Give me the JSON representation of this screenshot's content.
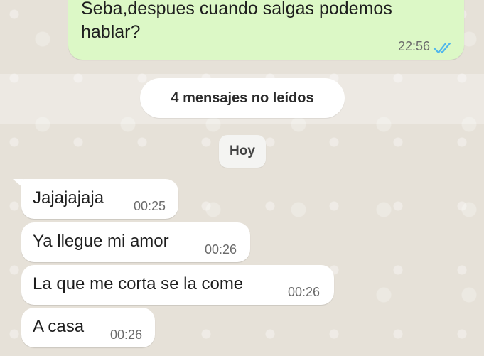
{
  "outgoing_message": {
    "text": "Seba,despues cuando salgas podemos hablar?",
    "time": "22:56",
    "status_icon": "double-check-read-icon",
    "bubble_color": "#dcf8c6",
    "tick_color": "#4fb6ec"
  },
  "unread_notice": {
    "label": "4 mensajes no leídos"
  },
  "date_separator": {
    "label": "Hoy"
  },
  "incoming_messages": [
    {
      "text": "Jajajajaja",
      "time": "00:25"
    },
    {
      "text": "Ya llegue mi amor",
      "time": "00:26"
    },
    {
      "text": "La que me corta se la come",
      "time": "00:26"
    },
    {
      "text": "A casa",
      "time": "00:26"
    }
  ]
}
